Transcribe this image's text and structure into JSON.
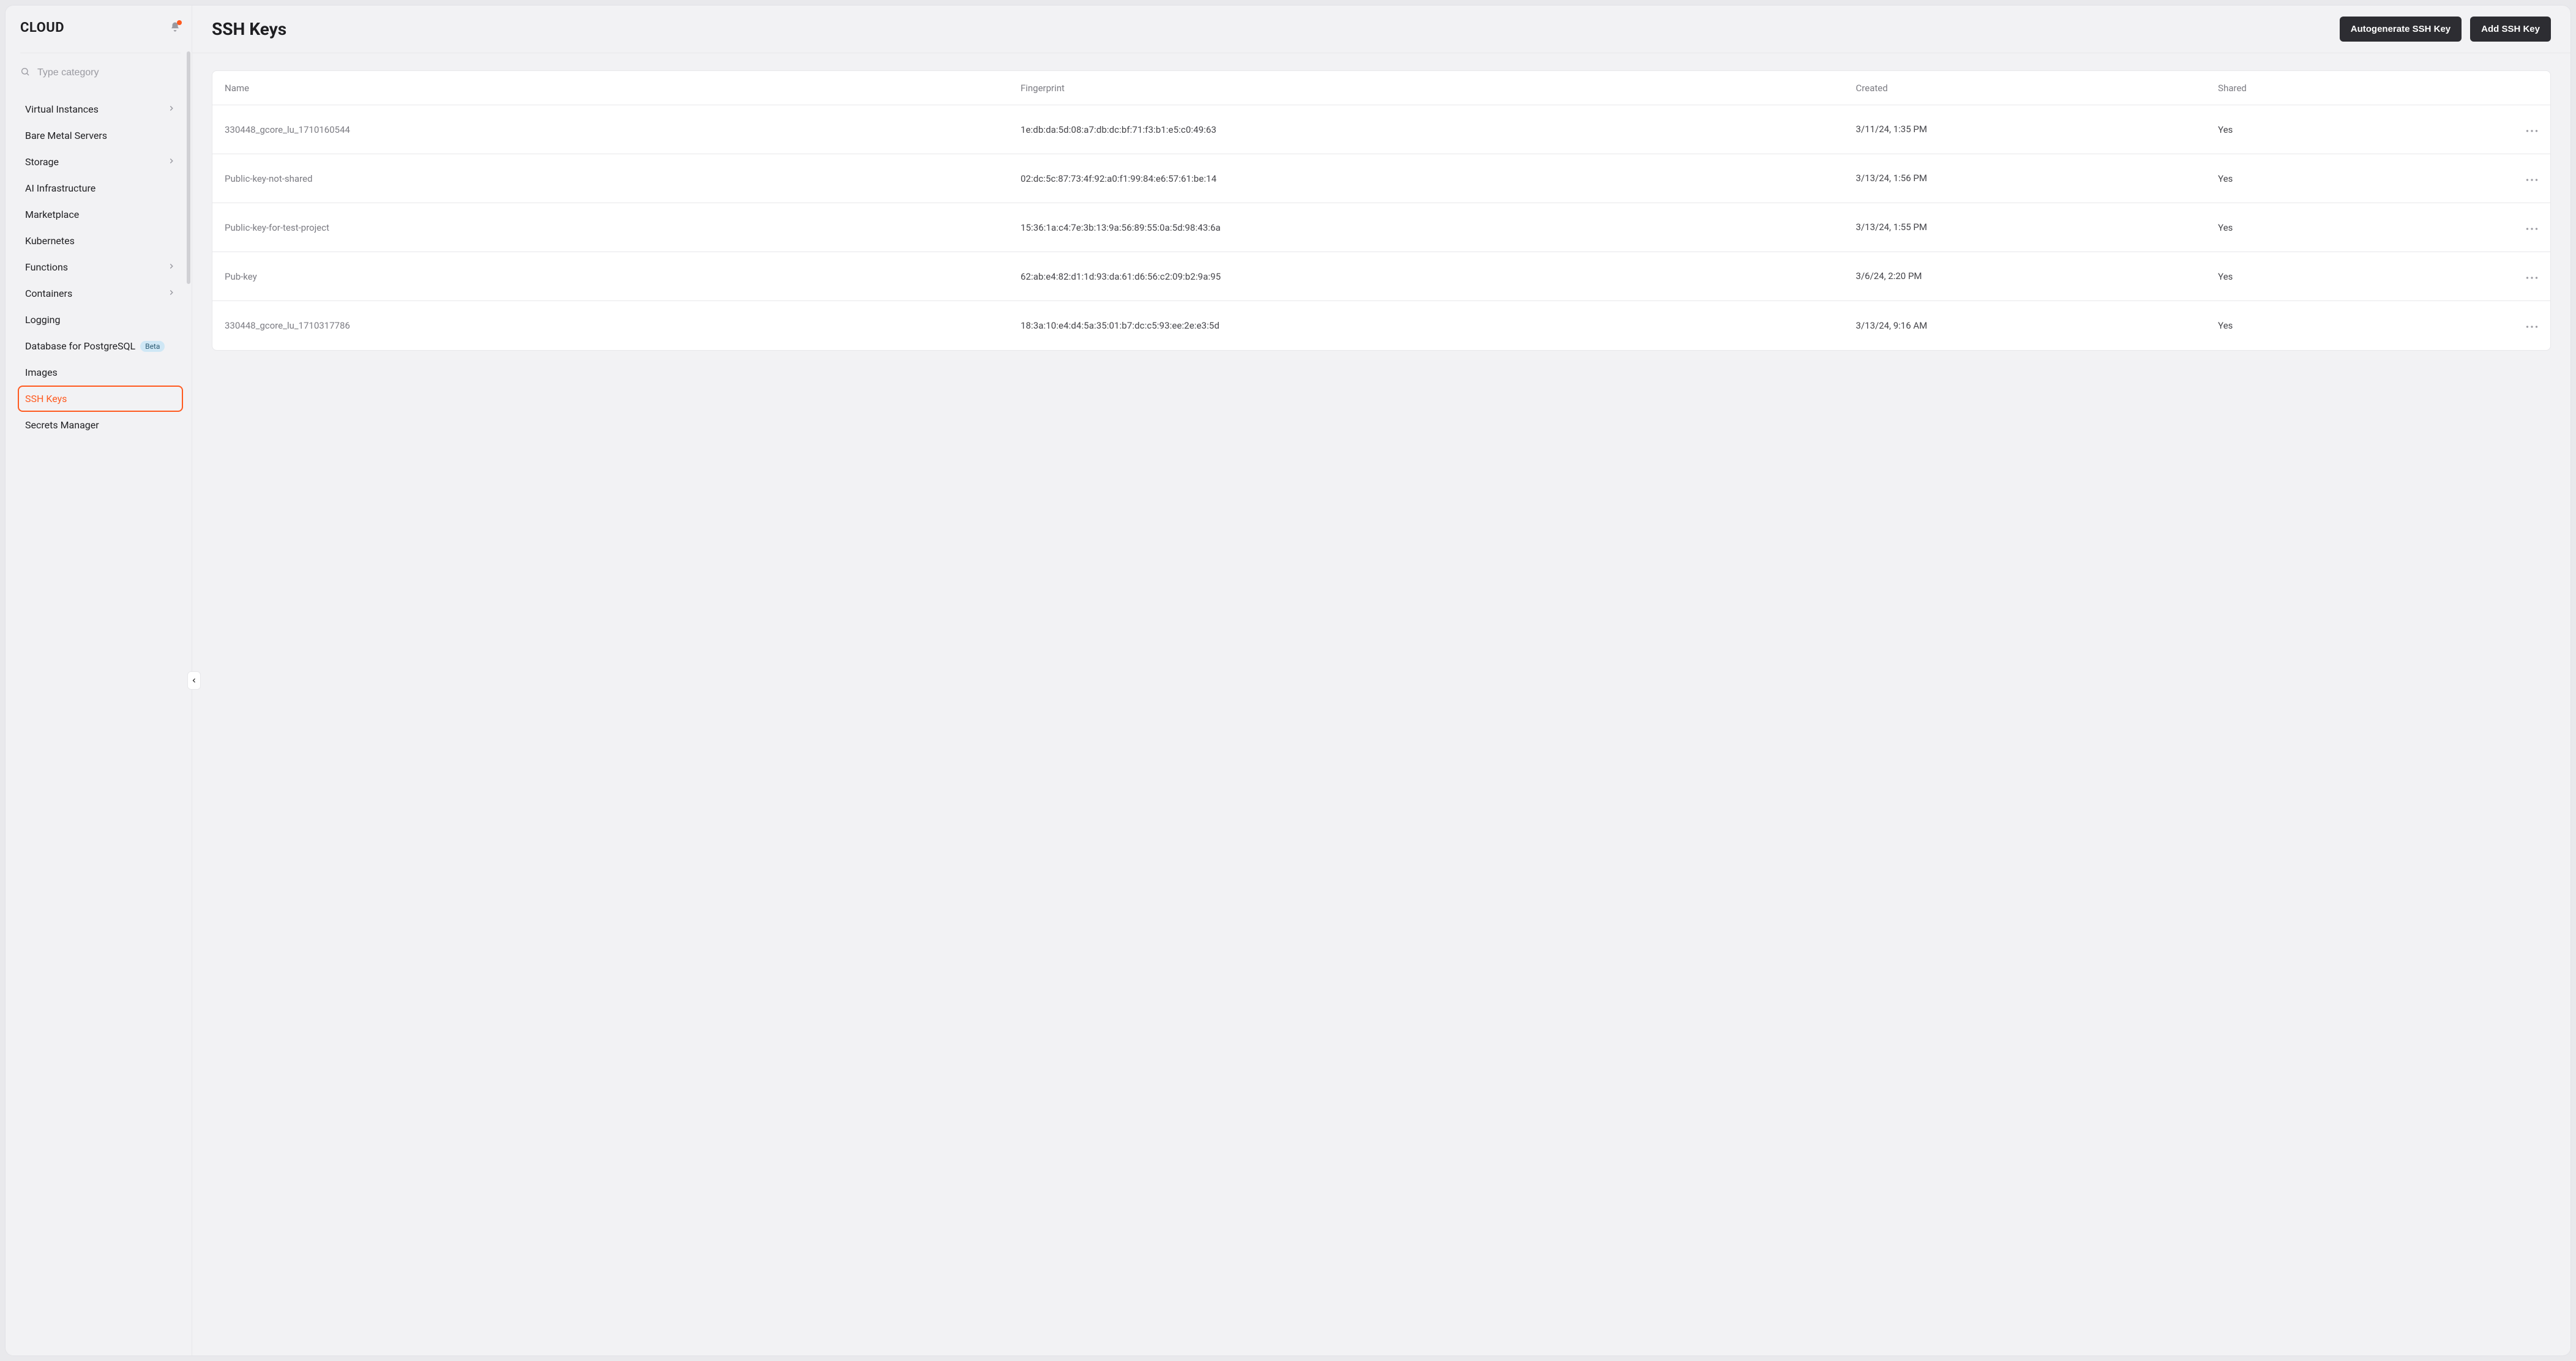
{
  "sidebar": {
    "brand": "CLOUD",
    "search_placeholder": "Type category",
    "items": [
      {
        "label": "Virtual Instances",
        "expandable": true
      },
      {
        "label": "Bare Metal Servers",
        "expandable": false
      },
      {
        "label": "Storage",
        "expandable": true
      },
      {
        "label": "AI Infrastructure",
        "expandable": false
      },
      {
        "label": "Marketplace",
        "expandable": false
      },
      {
        "label": "Kubernetes",
        "expandable": false
      },
      {
        "label": "Functions",
        "expandable": true
      },
      {
        "label": "Containers",
        "expandable": true
      },
      {
        "label": "Logging",
        "expandable": false
      },
      {
        "label": "Database for PostgreSQL",
        "expandable": false,
        "badge": "Beta"
      },
      {
        "label": "Images",
        "expandable": false
      },
      {
        "label": "SSH Keys",
        "expandable": false,
        "active": true
      },
      {
        "label": "Secrets Manager",
        "expandable": false
      }
    ]
  },
  "header": {
    "title": "SSH Keys",
    "autogen_btn": "Autogenerate SSH Key",
    "add_btn": "Add SSH Key"
  },
  "table": {
    "columns": {
      "name": "Name",
      "fingerprint": "Fingerprint",
      "created": "Created",
      "shared": "Shared"
    },
    "rows": [
      {
        "name": "330448_gcore_lu_1710160544",
        "fingerprint": "1e:db:da:5d:08:a7:db:dc:bf:71:f3:b1:e5:c0:49:63",
        "created": "3/11/24, 1:35 PM",
        "shared": "Yes"
      },
      {
        "name": "Public-key-not-shared",
        "fingerprint": "02:dc:5c:87:73:4f:92:a0:f1:99:84:e6:57:61:be:14",
        "created": "3/13/24, 1:56 PM",
        "shared": "Yes"
      },
      {
        "name": "Public-key-for-test-project",
        "fingerprint": "15:36:1a:c4:7e:3b:13:9a:56:89:55:0a:5d:98:43:6a",
        "created": "3/13/24, 1:55 PM",
        "shared": "Yes"
      },
      {
        "name": "Pub-key",
        "fingerprint": "62:ab:e4:82:d1:1d:93:da:61:d6:56:c2:09:b2:9a:95",
        "created": "3/6/24, 2:20 PM",
        "shared": "Yes"
      },
      {
        "name": "330448_gcore_lu_1710317786",
        "fingerprint": "18:3a:10:e4:d4:5a:35:01:b7:dc:c5:93:ee:2e:e3:5d",
        "created": "3/13/24, 9:16 AM",
        "shared": "Yes"
      }
    ]
  }
}
